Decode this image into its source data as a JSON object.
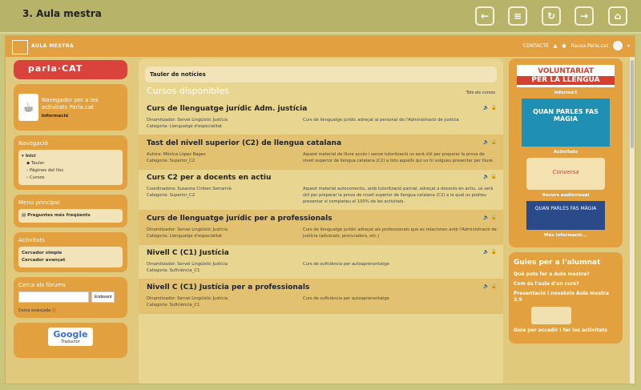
{
  "topbar": {
    "title": "3. Aula mestra",
    "buttons": [
      "back",
      "menu",
      "refresh",
      "forward",
      "home"
    ]
  },
  "appbar": {
    "brand": "AULA MESTRA",
    "contact": "CONTACTE",
    "user": "Rausa Parla.cat"
  },
  "left": {
    "parla_logo": "parla·CAT",
    "navigator_title": "Navegador per a les activitats Parla.cat",
    "navigator_info": "Informació",
    "nav_heading": "Navegació",
    "nav_items": [
      "Inici",
      "Tauler",
      "Pàgines del lloc",
      "Cursos"
    ],
    "menu_heading": "Menú principal",
    "menu_item": "Preguntes més freqüents",
    "activities_heading": "Activitats",
    "activities_items": [
      "Cercador simple",
      "Cercador avançat"
    ],
    "forum_heading": "Cerca als fòrums",
    "forum_button": "Endavant",
    "forum_advanced": "Cerca avançada",
    "google_title": "Google",
    "google_sub": "Traductor"
  },
  "main": {
    "news": "Tauler de notícies",
    "courses_title": "Cursos disponibles",
    "all_courses": "Tots els cursos",
    "courses": [
      {
        "title": "Curs de llenguatge jurídic Adm. justícia",
        "meta": [
          "Dinamitzador: Servei Lingüístic Justícia",
          "Categoria: Llenguatge d'especialitat"
        ],
        "desc": "Curs de llenguatge jurídic adreçat al personal de l'Administració de justícia"
      },
      {
        "title": "Tast del nivell superior (C2) de llengua catalana",
        "meta": [
          "Autora: Mònica López Bages",
          "Categoria: Superior_C2"
        ],
        "desc": "Aquest material de lliure accés i sense tutorització us serà útil per preparar la prova de nivell superior de llengua catalana (C2) a tots aquells qui us hi vulgueu presentar per lliure."
      },
      {
        "title": "Curs C2 per a docents en actiu",
        "meta": [
          "Coordinadora: Susanna Cirbian Serramià",
          "Categoria: Superior_C2"
        ],
        "desc": "Aquest material autocorrectiu, amb tutorització parcial, adreçat a docents en actiu, us serà útil per preparar la prova de nivell superior de llengua catalana (C2) a la qual us podreu presentar si completeu el 100% de les activitats."
      },
      {
        "title": "Curs de llenguatge jurídic per a professionals",
        "meta": [
          "Dinamitzador: Servei Lingüístic Justícia",
          "Categoria: Llenguatge d'especialitat"
        ],
        "desc": "Curs de llenguatge jurídic adreçat als professionals que es relacionen amb l'Administració de justícia (advocats, procuradors, etc.)"
      },
      {
        "title": "Nivell C (C1) Justícia",
        "meta": [
          "Dinamitzador: Servei Lingüístic Justícia",
          "Categoria: Suficiència_C1"
        ],
        "desc": "Curs de suficiència per autoaprenentatge"
      },
      {
        "title": "Nivell C (C1) Justícia per a professionals",
        "meta": [
          "Dinamitzador: Servei Lingüístic Justícia",
          "Categoria: Suficiència_C1"
        ],
        "desc": "Curs de suficiència per autoaprenentatge"
      }
    ]
  },
  "right": {
    "vol_line1": "VOLUNTARIAT",
    "vol_line2": "PER LA LLENGUA",
    "informat": "Informa't",
    "poster_text": "QUAN PARLES FAS MÀGIA",
    "activitats": "Activitats",
    "illus_text": "Conversa",
    "recurs": "Recurs audiovisual",
    "video_text": "QUAN PARLES FAS MÀGIA",
    "mes_info": "Més informació...",
    "guies_title": "Guies per a l'alumnat",
    "guies_items": [
      "Què pots fer a Aula mestra?",
      "Com és l'aula d'un curs?",
      "Presentació i novetats Aula mestra 3.9",
      "Guia per accedir i fer les activitats"
    ]
  }
}
